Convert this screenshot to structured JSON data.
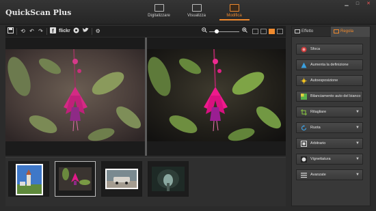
{
  "app": {
    "title": "QuickScan Plus"
  },
  "window_controls": {
    "minimize": "▁",
    "maximize": "□",
    "close": "✕"
  },
  "modes": [
    {
      "label": "Digitalizzare",
      "icon": "scanner-icon",
      "active": false
    },
    {
      "label": "Visualizza",
      "icon": "gallery-icon",
      "active": false
    },
    {
      "label": "Modifica",
      "icon": "edit-icon",
      "active": true
    }
  ],
  "toolbar": {
    "flickr": "flickr",
    "icons": [
      "save-icon",
      "undo-icon",
      "rotate-left-icon",
      "rotate-right-icon",
      "facebook-icon",
      "flickr-icon",
      "share-icon",
      "twitter-icon",
      "settings-icon"
    ],
    "zoom": {
      "level": 0.2
    },
    "view_modes": [
      "grid-view",
      "list-view",
      "compare-view",
      "split-view"
    ]
  },
  "preview": {
    "mode": "before-after",
    "subject": "pink fuchsia flower"
  },
  "filmstrip": [
    {
      "subject": "church",
      "selected": false
    },
    {
      "subject": "fuchsia flower",
      "selected": true
    },
    {
      "subject": "vintage car",
      "selected": false
    },
    {
      "subject": "tunnel",
      "selected": false
    }
  ],
  "panel": {
    "tabs": [
      {
        "label": "Effetto",
        "active": false
      },
      {
        "label": "Regola",
        "active": true
      }
    ],
    "buttons": [
      {
        "label": "Sfoca",
        "icon": "blur-icon",
        "dropdown": false
      },
      {
        "label": "Aumenta la definizione",
        "icon": "sharpen-icon",
        "dropdown": false
      },
      {
        "label": "Autoesposizione",
        "icon": "exposure-icon",
        "dropdown": false
      },
      {
        "label": "Bilanciamento auto del bianco",
        "icon": "white-balance-icon",
        "dropdown": false
      },
      {
        "label": "Ritagliare",
        "icon": "crop-icon",
        "dropdown": true
      },
      {
        "label": "Ruota",
        "icon": "rotate-icon",
        "dropdown": true
      },
      {
        "label": "Arbitrario",
        "icon": "arbitrary-icon",
        "dropdown": true
      },
      {
        "label": "Vignettatura",
        "icon": "vignette-icon",
        "dropdown": true
      },
      {
        "label": "Avanzate",
        "icon": "advanced-icon",
        "dropdown": true
      }
    ]
  },
  "colors": {
    "accent": "#f08a2e",
    "background": "#2b2b2b",
    "panel": "#383838"
  }
}
